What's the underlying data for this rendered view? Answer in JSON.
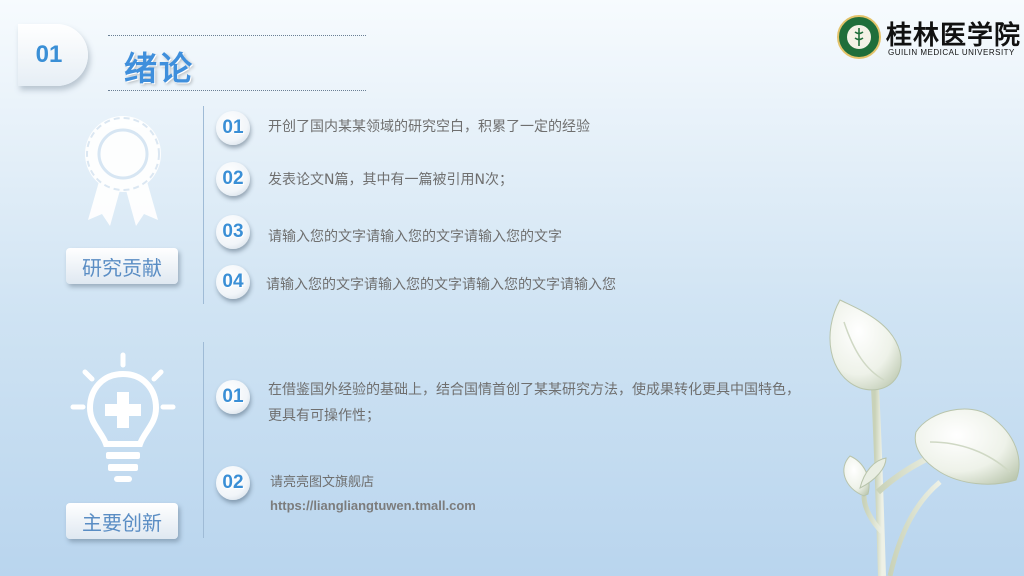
{
  "header": {
    "section_number": "01",
    "title": "绪论"
  },
  "logo": {
    "name_cn": "桂林医学院",
    "name_en": "GUILIN MEDICAL UNIVERSITY"
  },
  "sections": [
    {
      "label": "研究贡献",
      "icon": "award-ribbon-icon",
      "items": [
        {
          "num": "01",
          "text": "开创了国内某某领域的研究空白，积累了一定的经验"
        },
        {
          "num": "02",
          "text": "发表论文N篇，其中有一篇被引用N次；"
        },
        {
          "num": "03",
          "text": "请输入您的文字请输入您的文字请输入您的文字"
        },
        {
          "num": "04",
          "text": "请输入您的文字请输入您的文字请输入您的文字请输入您"
        }
      ]
    },
    {
      "label": "主要创新",
      "icon": "lightbulb-plus-icon",
      "items": [
        {
          "num": "01",
          "line1": "在借鉴国外经验的基础上，结合国情首创了某某研究方法，使成果转化更具中国特色，",
          "line2": "更具有可操作性；"
        },
        {
          "num": "02",
          "line1": "请亮亮图文旗舰店",
          "line2": "https://liangliangtuwen.tmall.com"
        }
      ]
    }
  ],
  "colors": {
    "accent": "#3a8fd6",
    "title": "#3f8fdc",
    "label_text": "#5a8dc4",
    "body_text": "#6f6f6f"
  }
}
